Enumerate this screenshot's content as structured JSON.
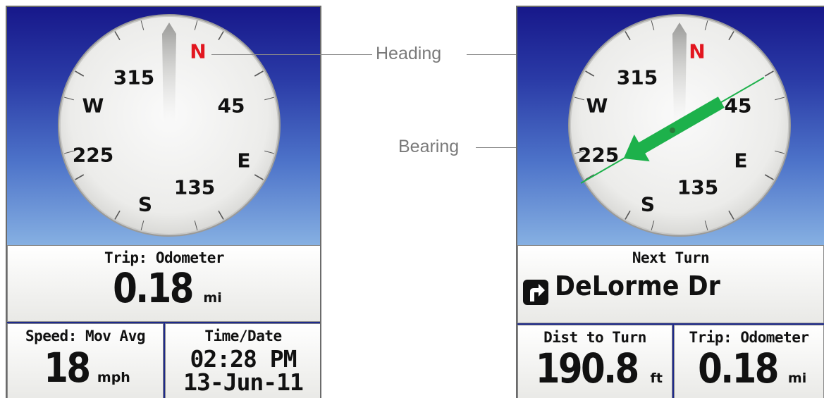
{
  "left_device": {
    "compass": {
      "labels": {
        "north": "N",
        "east": "E",
        "south": "S",
        "west": "W",
        "d45": "45",
        "d135": "135",
        "d225": "225",
        "d315": "315"
      },
      "heading_deg": 0,
      "north_color": "#e2161f"
    },
    "odometer": {
      "title": "Trip: Odometer",
      "value": "0.18",
      "unit": "mi"
    },
    "speed": {
      "title": "Speed: Mov Avg",
      "value": "18",
      "unit": "mph"
    },
    "timedate": {
      "title": "Time/Date",
      "time": "02:28 PM",
      "date": "13-Jun-11"
    }
  },
  "right_device": {
    "compass": {
      "labels": {
        "north": "N",
        "east": "E",
        "south": "S",
        "west": "W",
        "d45": "45",
        "d135": "135",
        "d225": "225",
        "d315": "315"
      },
      "heading_deg": 0,
      "bearing_deg": 240,
      "bearing_color": "#1db14b"
    },
    "next_turn": {
      "title": "Next Turn",
      "street": "DeLorme Dr",
      "icon": "turn-right-icon"
    },
    "dist_to_turn": {
      "title": "Dist to Turn",
      "value": "190.8",
      "unit": "ft"
    },
    "odometer": {
      "title": "Trip: Odometer",
      "value": "0.18",
      "unit": "mi"
    }
  },
  "callouts": {
    "heading": "Heading",
    "bearing": "Bearing"
  }
}
